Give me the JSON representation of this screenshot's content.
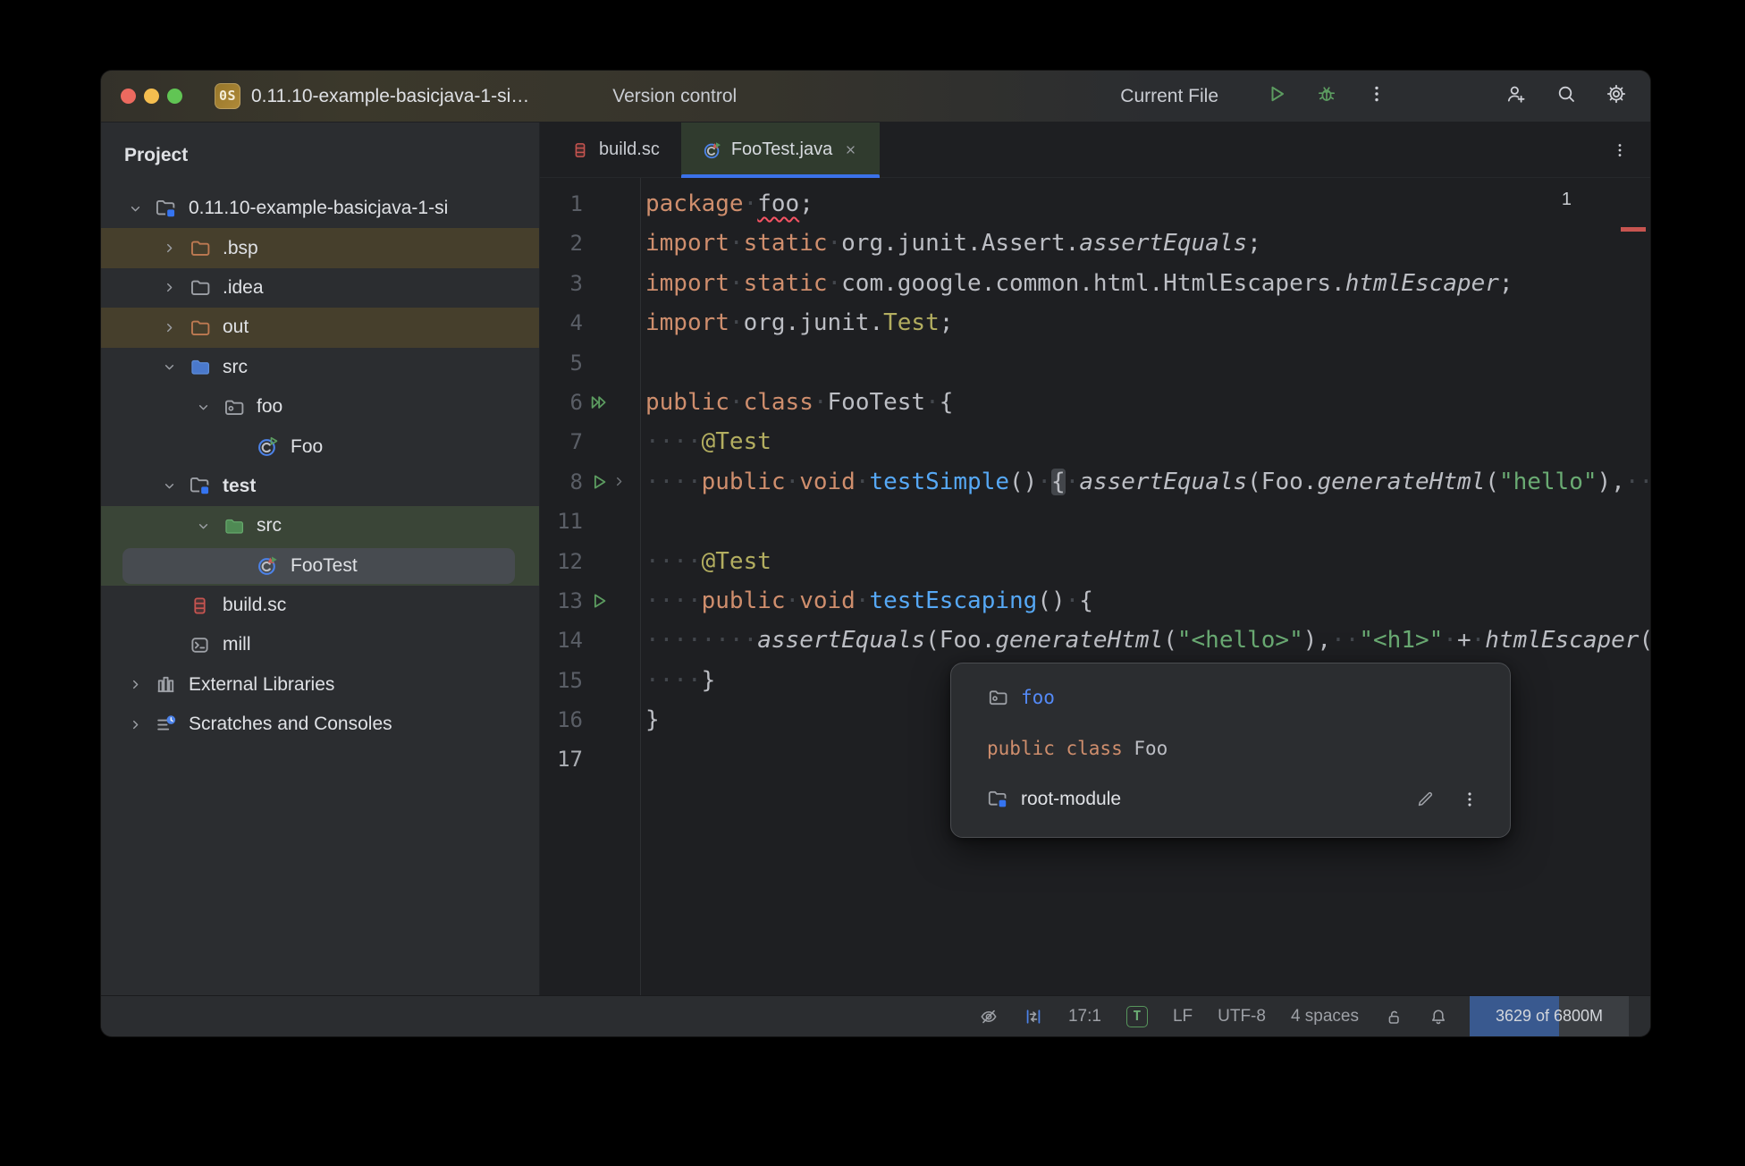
{
  "colors": {
    "accent_blue": "#3574F0",
    "run_green": "#5C9C60",
    "error_red": "#DB5F5A",
    "excluded_row": "#463F2C",
    "test_row_green": "#3A4537",
    "memory_fill_blue": "#39598F"
  },
  "titlebar": {
    "traffic_lights": [
      "close",
      "minimize",
      "zoom"
    ],
    "project_badge": "0S",
    "project_title": "0.11.10-example-basicjava-1-si…",
    "version_control_label": "Version control",
    "run_config_label": "Current File",
    "run_controls": [
      {
        "icon": "run-icon",
        "name": "run-button"
      },
      {
        "icon": "debug-icon",
        "name": "debug-button"
      },
      {
        "icon": "kebab-icon",
        "name": "more-actions-button"
      }
    ],
    "right_icons": [
      {
        "icon": "user-plus-icon",
        "name": "code-with-me-button"
      },
      {
        "icon": "search-icon",
        "name": "search-everywhere-button"
      },
      {
        "icon": "gear-icon",
        "name": "settings-button"
      }
    ]
  },
  "project_panel": {
    "header_label": "Project",
    "tree": [
      {
        "label": "0.11.10-example-basicjava-1-si",
        "indent": 0,
        "expand": "open",
        "icon": "module-folder-icon",
        "highlight": null,
        "selected": false,
        "bold": false
      },
      {
        "label": ".bsp",
        "indent": 1,
        "expand": "closed",
        "icon": "excluded-folder-icon",
        "highlight": "excluded",
        "selected": false,
        "bold": false
      },
      {
        "label": ".idea",
        "indent": 1,
        "expand": "closed",
        "icon": "folder-icon",
        "highlight": null,
        "selected": false,
        "bold": false
      },
      {
        "label": "out",
        "indent": 1,
        "expand": "closed",
        "icon": "excluded-folder-icon",
        "highlight": "excluded",
        "selected": false,
        "bold": false
      },
      {
        "label": "src",
        "indent": 1,
        "expand": "open",
        "icon": "source-folder-icon",
        "highlight": null,
        "selected": false,
        "bold": false
      },
      {
        "label": "foo",
        "indent": 2,
        "expand": "open",
        "icon": "package-folder-icon",
        "highlight": null,
        "selected": false,
        "bold": false
      },
      {
        "label": "Foo",
        "indent": 3,
        "expand": null,
        "icon": "java-class-icon",
        "highlight": null,
        "selected": false,
        "bold": false
      },
      {
        "label": "test",
        "indent": 1,
        "expand": "open",
        "icon": "module-folder-icon",
        "highlight": null,
        "selected": false,
        "bold": true
      },
      {
        "label": "src",
        "indent": 2,
        "expand": "open",
        "icon": "test-folder-icon",
        "highlight": "test",
        "selected": false,
        "bold": false
      },
      {
        "label": "FooTest",
        "indent": 3,
        "expand": null,
        "icon": "java-test-class-icon",
        "highlight": "test",
        "selected": true,
        "bold": false
      },
      {
        "label": "build.sc",
        "indent": 1,
        "expand": null,
        "icon": "scala-file-icon",
        "highlight": null,
        "selected": false,
        "bold": false
      },
      {
        "label": "mill",
        "indent": 1,
        "expand": null,
        "icon": "terminal-file-icon",
        "highlight": null,
        "selected": false,
        "bold": false
      },
      {
        "label": "External Libraries",
        "indent": 0,
        "expand": "closed",
        "icon": "library-icon",
        "highlight": null,
        "selected": false,
        "bold": false
      },
      {
        "label": "Scratches and Consoles",
        "indent": 0,
        "expand": "closed",
        "icon": "scratches-icon",
        "highlight": null,
        "selected": false,
        "bold": false
      }
    ]
  },
  "editor": {
    "tabs": [
      {
        "label": "build.sc",
        "icon": "scala-file-icon",
        "active": false,
        "closable": false
      },
      {
        "label": "FooTest.java",
        "icon": "java-test-class-icon",
        "active": true,
        "closable": true
      }
    ],
    "tab_options_icon": "kebab-icon",
    "error_widget": {
      "count": "1"
    },
    "lines": [
      {
        "num": "1",
        "seg": [
          [
            "kw",
            "package"
          ],
          [
            "ws",
            "·"
          ],
          [
            "err",
            "foo"
          ],
          [
            "id",
            ";"
          ]
        ]
      },
      {
        "num": "2",
        "seg": [
          [
            "kw",
            "import"
          ],
          [
            "ws",
            "·"
          ],
          [
            "kw",
            "static"
          ],
          [
            "ws",
            "·"
          ],
          [
            "id",
            "org.junit.Assert."
          ],
          [
            "it",
            "assertEquals"
          ],
          [
            "id",
            ";"
          ]
        ]
      },
      {
        "num": "3",
        "seg": [
          [
            "kw",
            "import"
          ],
          [
            "ws",
            "·"
          ],
          [
            "kw",
            "static"
          ],
          [
            "ws",
            "·"
          ],
          [
            "id",
            "com.google.common.html.HtmlEscapers."
          ],
          [
            "it",
            "htmlEscaper"
          ],
          [
            "id",
            ";"
          ]
        ]
      },
      {
        "num": "4",
        "seg": [
          [
            "kw",
            "import"
          ],
          [
            "ws",
            "·"
          ],
          [
            "id",
            "org.junit."
          ],
          [
            "cls",
            "Test"
          ],
          [
            "id",
            ";"
          ]
        ]
      },
      {
        "num": "5",
        "seg": []
      },
      {
        "num": "6",
        "gutter": "run-all-icon",
        "seg": [
          [
            "kw",
            "public"
          ],
          [
            "ws",
            "·"
          ],
          [
            "kw",
            "class"
          ],
          [
            "ws",
            "·"
          ],
          [
            "id",
            "FooTest"
          ],
          [
            "ws",
            "·"
          ],
          [
            "id",
            "{"
          ]
        ]
      },
      {
        "num": "7",
        "seg": [
          [
            "ws",
            "····"
          ],
          [
            "ann",
            "@Test"
          ]
        ]
      },
      {
        "num": "8",
        "gutter": "run-icon",
        "fold": true,
        "seg": [
          [
            "ws",
            "····"
          ],
          [
            "kw",
            "public"
          ],
          [
            "ws",
            "·"
          ],
          [
            "kw",
            "void"
          ],
          [
            "ws",
            "·"
          ],
          [
            "md",
            "testSimple"
          ],
          [
            "id",
            "()"
          ],
          [
            "ws",
            "·"
          ],
          [
            "fb",
            "{"
          ],
          [
            "ws",
            "·"
          ],
          [
            "it",
            "assertEquals"
          ],
          [
            "id",
            "(Foo."
          ],
          [
            "it",
            "generateHtml"
          ],
          [
            "id",
            "("
          ],
          [
            "str",
            "\"hello\""
          ],
          [
            "id",
            "),"
          ],
          [
            "ws",
            "···"
          ]
        ]
      },
      {
        "num": "11",
        "seg": []
      },
      {
        "num": "12",
        "seg": [
          [
            "ws",
            "····"
          ],
          [
            "ann",
            "@Test"
          ]
        ]
      },
      {
        "num": "13",
        "gutter": "run-icon",
        "seg": [
          [
            "ws",
            "····"
          ],
          [
            "kw",
            "public"
          ],
          [
            "ws",
            "·"
          ],
          [
            "kw",
            "void"
          ],
          [
            "ws",
            "·"
          ],
          [
            "md",
            "testEscaping"
          ],
          [
            "id",
            "()"
          ],
          [
            "ws",
            "·"
          ],
          [
            "id",
            "{"
          ]
        ]
      },
      {
        "num": "14",
        "seg": [
          [
            "ws",
            "········"
          ],
          [
            "it",
            "assertEquals"
          ],
          [
            "id",
            "(Foo."
          ],
          [
            "it",
            "generateHtml"
          ],
          [
            "id",
            "("
          ],
          [
            "str",
            "\"<hello>\""
          ],
          [
            "id",
            "),"
          ],
          [
            "ws",
            "··"
          ],
          [
            "str",
            "\"<h1>\""
          ],
          [
            "ws",
            "·"
          ],
          [
            "id",
            "+"
          ],
          [
            "ws",
            "·"
          ],
          [
            "it",
            "htmlEscaper"
          ],
          [
            "id",
            "("
          ]
        ]
      },
      {
        "num": "15",
        "seg": [
          [
            "ws",
            "····"
          ],
          [
            "id",
            "}"
          ]
        ]
      },
      {
        "num": "16",
        "seg": [
          [
            "id",
            "}"
          ]
        ]
      },
      {
        "num": "17",
        "current": true,
        "seg": []
      }
    ]
  },
  "popup": {
    "rows": [
      {
        "type": "package",
        "icon": "package-folder-icon",
        "segments": [
          [
            "pk",
            "foo"
          ]
        ]
      },
      {
        "type": "code",
        "segments": [
          [
            "kw",
            "public class "
          ],
          [
            "id",
            "Foo"
          ]
        ]
      },
      {
        "type": "module",
        "icon": "module-folder-icon",
        "label": "root-module",
        "actions": [
          {
            "icon": "pencil-icon",
            "name": "edit-module-button"
          },
          {
            "icon": "kebab-icon",
            "name": "module-options-button"
          }
        ]
      }
    ]
  },
  "statusbar": {
    "items": [
      {
        "name": "highlighting-level",
        "icon": "eye-off-icon"
      },
      {
        "name": "code-indents-widget",
        "icon": "indent-arrows-icon"
      },
      {
        "name": "caret-position",
        "text": "17:1"
      },
      {
        "name": "true-type-badge",
        "badge": "T"
      },
      {
        "name": "line-separator",
        "text": "LF"
      },
      {
        "name": "file-encoding",
        "text": "UTF-8"
      },
      {
        "name": "indent-size",
        "text": "4 spaces"
      },
      {
        "name": "readonly-toggle",
        "icon": "lock-open-icon"
      },
      {
        "name": "notifications",
        "icon": "bell-icon"
      },
      {
        "name": "memory-indicator",
        "memory": "3629 of 6800M"
      }
    ]
  }
}
